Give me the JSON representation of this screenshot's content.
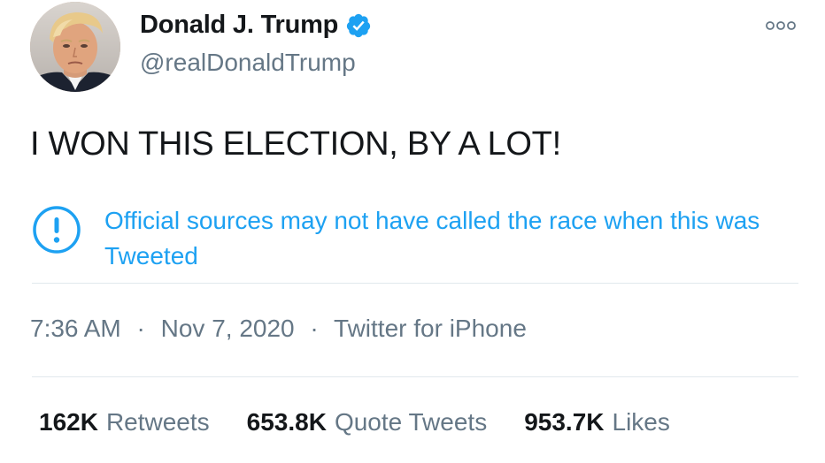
{
  "user": {
    "display_name": "Donald J. Trump",
    "handle": "@realDonaldTrump",
    "verified": true,
    "avatar_icon": "avatar-photo"
  },
  "tweet": {
    "text": "I WON THIS ELECTION, BY A LOT!"
  },
  "notice": {
    "icon": "info-exclamation-icon",
    "text": "Official sources may not have called the race when this was Tweeted"
  },
  "meta": {
    "time": "7:36 AM",
    "date": "Nov 7, 2020",
    "source": "Twitter for iPhone",
    "separator": "·"
  },
  "stats": {
    "retweets_count": "162K",
    "retweets_label": "Retweets",
    "quotes_count": "653.8K",
    "quotes_label": "Quote Tweets",
    "likes_count": "953.7K",
    "likes_label": "Likes"
  },
  "colors": {
    "accent": "#1da1f2",
    "text": "#14171a",
    "secondary": "#657786",
    "divider": "#e1e8ed"
  }
}
